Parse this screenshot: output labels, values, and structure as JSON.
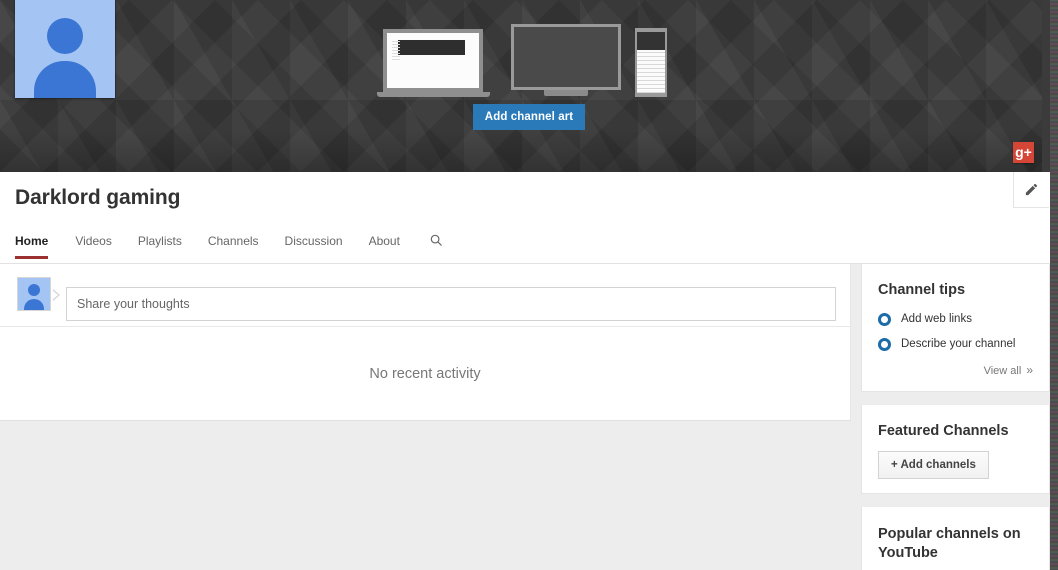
{
  "banner": {
    "avatar_icon": "person-avatar-icon",
    "add_channel_art_label": "Add channel art",
    "devices": [
      {
        "name": "laptop-mockup"
      },
      {
        "name": "tv-mockup"
      },
      {
        "name": "phone-mockup"
      }
    ],
    "gplus_label": "g+",
    "background_color": "#3b3b3b"
  },
  "header": {
    "channel_title": "Darklord gaming",
    "edit_icon": "pencil-icon",
    "tabs": [
      {
        "label": "Home",
        "active": true
      },
      {
        "label": "Videos",
        "active": false
      },
      {
        "label": "Playlists",
        "active": false
      },
      {
        "label": "Channels",
        "active": false
      },
      {
        "label": "Discussion",
        "active": false
      },
      {
        "label": "About",
        "active": false
      }
    ],
    "search_icon": "search-icon",
    "active_tab_underline_color": "#9c3030"
  },
  "main": {
    "composer": {
      "avatar_icon": "person-avatar-icon",
      "placeholder": "Share your thoughts",
      "value": ""
    },
    "empty_state": "No recent activity"
  },
  "sidebar": {
    "channel_tips": {
      "title": "Channel tips",
      "items": [
        {
          "label": "Add web links",
          "bullet_color": "#1b6ca8"
        },
        {
          "label": "Describe your channel",
          "bullet_color": "#1b6ca8"
        }
      ],
      "view_all_label": "View all",
      "view_all_chevron": "»"
    },
    "featured_channels": {
      "title": "Featured Channels",
      "add_button_label": "+ Add channels"
    },
    "popular_channels": {
      "title": "Popular channels on YouTube"
    }
  }
}
